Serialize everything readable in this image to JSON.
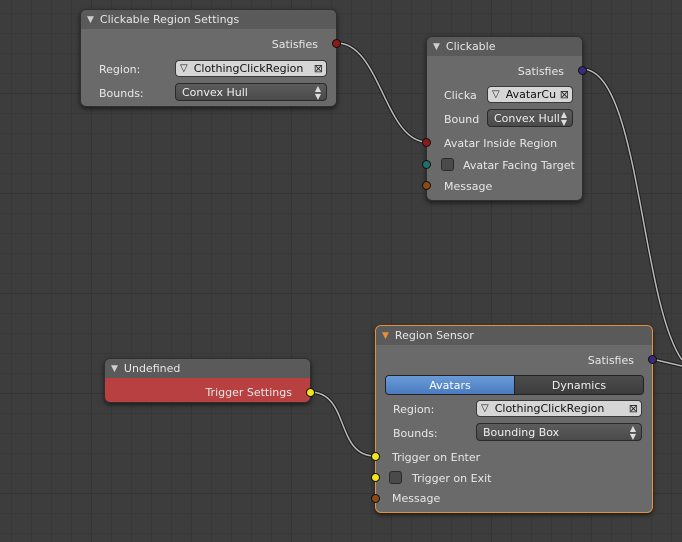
{
  "nodes": {
    "clickable_region_settings": {
      "title": "Clickable Region Settings",
      "output_label": "Satisfies",
      "region_label": "Region:",
      "region_value": "ClothingClickRegion",
      "bounds_label": "Bounds:",
      "bounds_value": "Convex Hull"
    },
    "clickable": {
      "title": "Clickable",
      "output_label": "Satisfies",
      "clicka_label": "Clicka",
      "clicka_value": "AvatarCu",
      "bound_label": "Bound",
      "bound_value": "Convex Hull",
      "input_avatar_inside": "Avatar Inside Region",
      "input_avatar_facing": "Avatar Facing Target",
      "input_message": "Message"
    },
    "undefined": {
      "title": "Undefined",
      "output_label": "Trigger Settings"
    },
    "region_sensor": {
      "title": "Region Sensor",
      "output_label": "Satisfies",
      "tabs": [
        "Avatars",
        "Dynamics"
      ],
      "region_label": "Region:",
      "region_value": "ClothingClickRegion",
      "bounds_label": "Bounds:",
      "bounds_value": "Bounding Box",
      "input_trigger_enter": "Trigger on Enter",
      "input_trigger_exit": "Trigger on Exit",
      "input_message": "Message"
    }
  },
  "colors": {
    "socket_red": "#8b1a1a",
    "socket_purple": "#3b2a7a",
    "socket_teal": "#1f6e6a",
    "socket_orange": "#8a4a12",
    "socket_yellow": "#f2e61a",
    "undefined_body": "#b84040",
    "active_border": "#e3913a",
    "tab_selected": "#5b8bd0"
  }
}
